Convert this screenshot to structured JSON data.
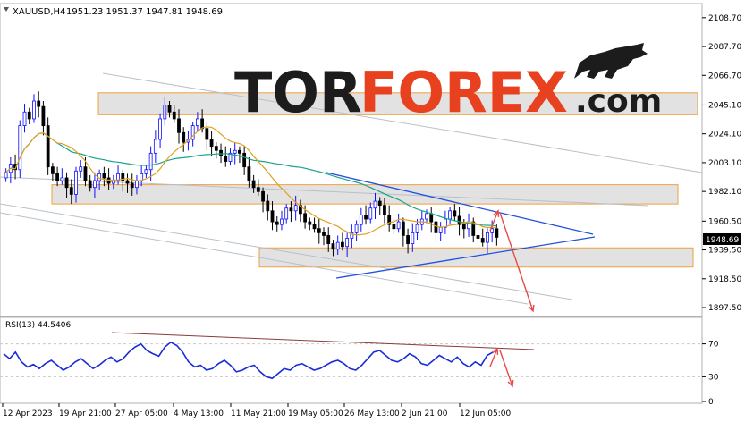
{
  "chart_data": [
    {
      "type": "candlestick",
      "title": "XAUUSD,H4  1951.23 1951.37 1947.81 1948.69",
      "symbol": "XAUUSD,H4",
      "ohlc_header": "1951.23 1951.37 1947.81 1948.69",
      "current_price": 1948.69,
      "current_price_label": "1948.69",
      "ylim": [
        1891,
        2119
      ],
      "y_ticks": [
        2108.7,
        2087.7,
        2066.7,
        2045.1,
        2024.1,
        2003.1,
        1982.1,
        1960.5,
        1939.5,
        1918.5,
        1897.5
      ],
      "y_tick_labels": [
        "2108.70",
        "2087.70",
        "2066.70",
        "2045.10",
        "2024.10",
        "2003.10",
        "1982.10",
        "1960.50",
        "1939.50",
        "1918.50",
        "1897.50"
      ],
      "x_tick_labels": [
        "12 Apr 2023",
        "19 Apr 21:00",
        "27 Apr 05:00",
        "4 May 13:00",
        "11 May 21:00",
        "19 May 05:00",
        "26 May 13:00",
        "2 Jun 21:00",
        "12 Jun 05:00"
      ],
      "close_series": [
        1996,
        2002,
        1998,
        2030,
        2040,
        2035,
        2048,
        2044,
        2030,
        2000,
        1995,
        1990,
        1992,
        1985,
        1980,
        1997,
        2000,
        1990,
        1985,
        1990,
        1995,
        1992,
        1988,
        1990,
        1995,
        1990,
        1988,
        1985,
        1990,
        1995,
        1998,
        2010,
        2020,
        2035,
        2045,
        2040,
        2035,
        2025,
        2018,
        2020,
        2030,
        2035,
        2028,
        2020,
        2015,
        2012,
        2008,
        2004,
        2010,
        2012,
        2010,
        2000,
        1990,
        1985,
        1982,
        1975,
        1968,
        1960,
        1958,
        1962,
        1970,
        1968,
        1972,
        1966,
        1960,
        1958,
        1955,
        1952,
        1950,
        1944,
        1940,
        1945,
        1942,
        1948,
        1952,
        1958,
        1965,
        1962,
        1970,
        1975,
        1972,
        1965,
        1958,
        1955,
        1960,
        1950,
        1944,
        1952,
        1958,
        1962,
        1966,
        1960,
        1952,
        1956,
        1962,
        1968,
        1964,
        1958,
        1955,
        1960,
        1950,
        1948,
        1945,
        1952,
        1955,
        1948.69
      ],
      "ma_slow_name": "slow moving average (green)",
      "ma_fast_name": "fast moving average (orange)",
      "zones": [
        {
          "from": 2038,
          "to": 2054
        },
        {
          "from": 1973,
          "to": 1987
        },
        {
          "from": 1927,
          "to": 1941
        }
      ],
      "forecast": {
        "scenario": "up then down",
        "target_up": 1968,
        "target_down": 1895
      },
      "colors": {
        "up": "#1010ff",
        "down": "#000000",
        "ma_slow": "#1aa38c",
        "ma_fast": "#e0a020",
        "zone_fill": "#e2e2e2",
        "zone_border": "#f0a040",
        "arrow": "#e84a4a",
        "triangle": "#2050e0",
        "channel": "#b8c0c8"
      }
    },
    {
      "type": "line",
      "title": "RSI(13) 44.5406",
      "indicator": "RSI(13)",
      "value_label": "44.5406",
      "ylim": [
        0,
        100
      ],
      "y_ticks": [
        70,
        30,
        0
      ],
      "levels": [
        70,
        30
      ],
      "values": [
        58,
        52,
        60,
        48,
        42,
        45,
        40,
        46,
        50,
        44,
        38,
        42,
        48,
        52,
        46,
        40,
        44,
        50,
        54,
        48,
        52,
        60,
        66,
        70,
        62,
        58,
        55,
        66,
        72,
        68,
        60,
        48,
        42,
        44,
        38,
        40,
        46,
        50,
        44,
        36,
        38,
        42,
        44,
        36,
        30,
        28,
        34,
        40,
        38,
        44,
        46,
        42,
        38,
        40,
        44,
        48,
        50,
        46,
        40,
        38,
        44,
        52,
        60,
        62,
        56,
        50,
        48,
        52,
        58,
        54,
        46,
        44,
        50,
        56,
        52,
        48,
        54,
        46,
        42,
        48,
        44,
        56,
        60
      ],
      "trendline": "resistance falling",
      "colors": {
        "line": "#1a2cd8",
        "trend": "#8b3a3a",
        "arrow": "#e84a4a"
      }
    }
  ],
  "logo": {
    "part1": "TOR",
    "part2": "FOREX",
    "part3": ".com"
  },
  "logo_colors": {
    "part1": "#1c1c1c",
    "part2": "#e8411f",
    "part3": "#1c1c1c"
  }
}
